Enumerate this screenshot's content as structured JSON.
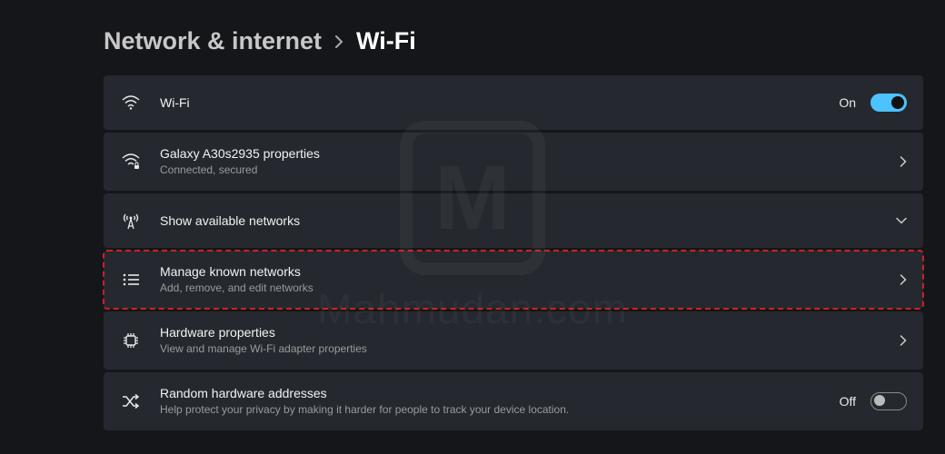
{
  "breadcrumb": {
    "parent": "Network & internet",
    "current": "Wi-Fi"
  },
  "watermark": {
    "logo_letter": "M",
    "text": "Mahmudan.com"
  },
  "items": {
    "wifi_toggle": {
      "title": "Wi-Fi",
      "status": "On"
    },
    "connected_network": {
      "title": "Galaxy A30s2935 properties",
      "subtitle": "Connected, secured"
    },
    "available_networks": {
      "title": "Show available networks"
    },
    "manage_known": {
      "title": "Manage known networks",
      "subtitle": "Add, remove, and edit networks"
    },
    "hardware": {
      "title": "Hardware properties",
      "subtitle": "View and manage Wi-Fi adapter properties"
    },
    "random_mac": {
      "title": "Random hardware addresses",
      "subtitle": "Help protect your privacy by making it harder for people to track your device location.",
      "status": "Off"
    }
  }
}
